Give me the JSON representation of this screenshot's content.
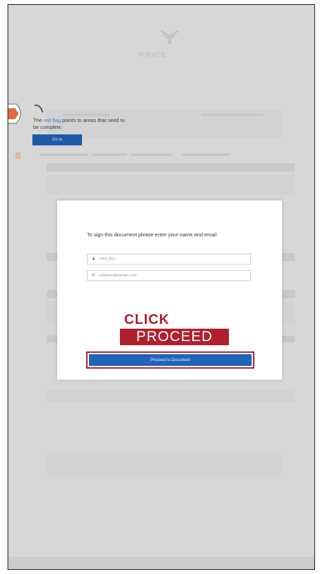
{
  "background": {
    "brand": "PRICE",
    "tip_text_before": "The ",
    "tip_link": "red flag",
    "tip_text_after": " points to areas that need to be complete.",
    "goto_label": "Go to"
  },
  "modal": {
    "prompt": "To sign this document please enter your name and email",
    "name_placeholder": "John Doe",
    "email_placeholder": "address@domain.com",
    "overlay_click": "CLICK",
    "overlay_proceed": "PROCEED",
    "proceed_button": "Proceed to Document"
  },
  "colors": {
    "accent_blue": "#1f66b8",
    "annotation_red": "#b11f2d"
  },
  "icons": {
    "name_field": "user-icon",
    "email_field": "mail-icon"
  }
}
